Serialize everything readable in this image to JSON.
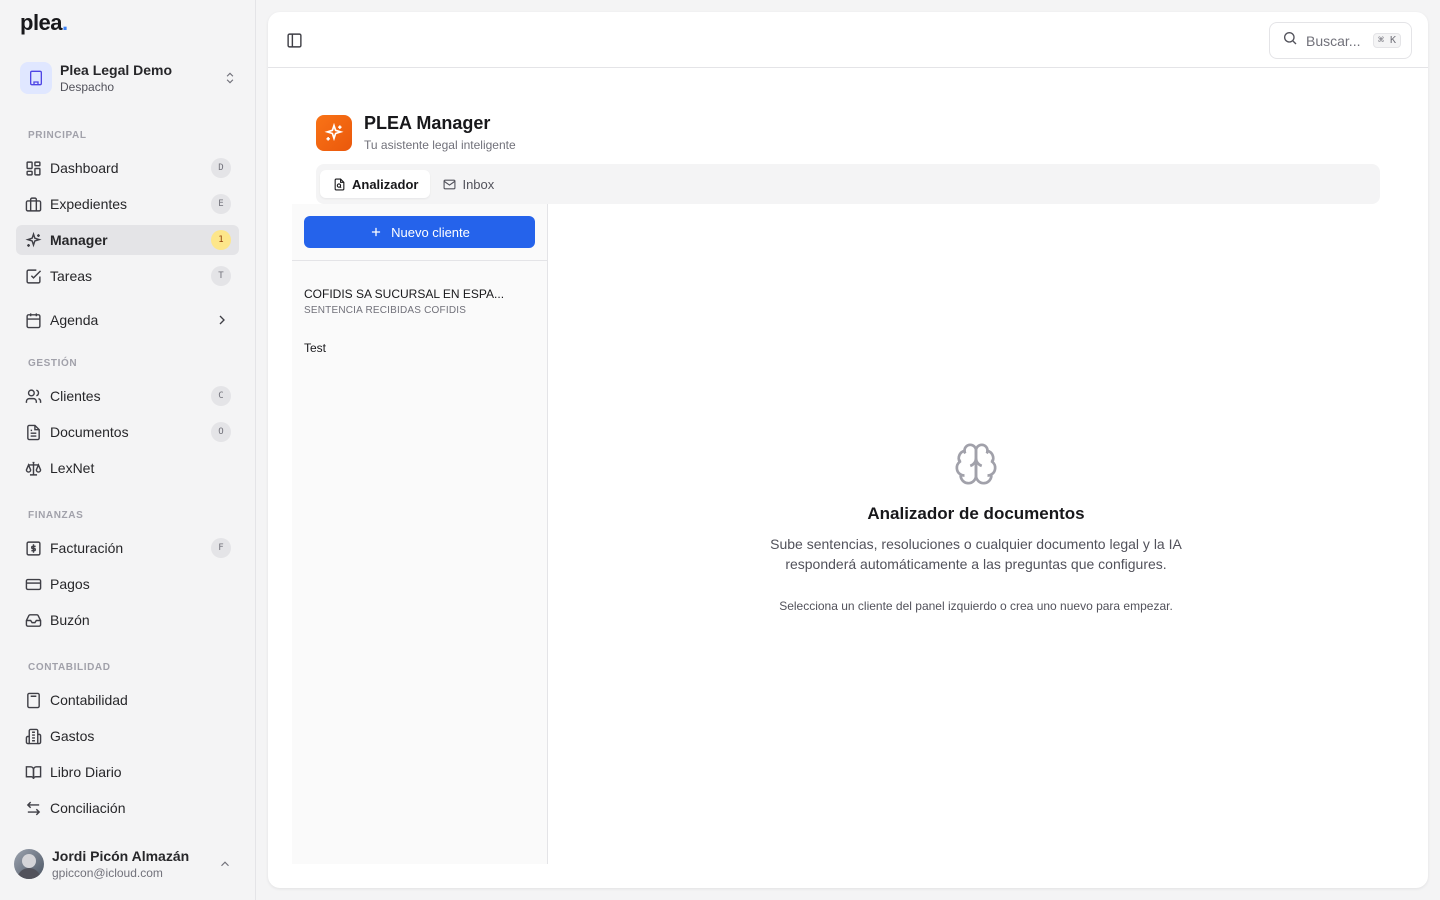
{
  "brand": {
    "logo_text": "plea",
    "logo_dot": "."
  },
  "org": {
    "name": "Plea Legal Demo",
    "subtitle": "Despacho"
  },
  "sidebar": {
    "sections": {
      "principal": "PRINCIPAL",
      "gestion": "GESTIÓN",
      "finanzas": "FINANZAS",
      "contabilidad": "CONTABILIDAD"
    },
    "items": {
      "dashboard": {
        "label": "Dashboard",
        "badge": "D",
        "icon": "dashboard-icon"
      },
      "expedientes": {
        "label": "Expedientes",
        "badge": "E",
        "icon": "briefcase-icon"
      },
      "manager": {
        "label": "Manager",
        "badge": "1",
        "icon": "sparkles-icon"
      },
      "tareas": {
        "label": "Tareas",
        "badge": "T",
        "icon": "checkbox-icon"
      },
      "agenda": {
        "label": "Agenda",
        "icon": "calendar-icon"
      },
      "clientes": {
        "label": "Clientes",
        "badge": "C",
        "icon": "users-icon"
      },
      "documentos": {
        "label": "Documentos",
        "badge": "O",
        "icon": "document-icon"
      },
      "lexnet": {
        "label": "LexNet",
        "icon": "scale-icon"
      },
      "facturacion": {
        "label": "Facturación",
        "badge": "F",
        "icon": "invoice-icon"
      },
      "pagos": {
        "label": "Pagos",
        "icon": "credit-card-icon"
      },
      "buzon": {
        "label": "Buzón",
        "icon": "inbox-icon"
      },
      "contabilidad": {
        "label": "Contabilidad",
        "icon": "calculator-icon"
      },
      "gastos": {
        "label": "Gastos",
        "icon": "receipt-icon"
      },
      "libro_diario": {
        "label": "Libro Diario",
        "icon": "book-icon"
      },
      "conciliacion": {
        "label": "Conciliación",
        "icon": "arrows-icon"
      }
    }
  },
  "user": {
    "name": "Jordi Picón Almazán",
    "email": "gpiccon@icloud.com"
  },
  "topbar": {
    "search_placeholder": "Buscar...",
    "shortcut": "⌘ K"
  },
  "app": {
    "title": "PLEA Manager",
    "subtitle": "Tu asistente legal inteligente"
  },
  "tabs": [
    {
      "label": "Analizador",
      "active": true
    },
    {
      "label": "Inbox",
      "active": false
    }
  ],
  "clients_panel": {
    "new_button": "Nuevo cliente",
    "clients": [
      {
        "name": "COFIDIS SA SUCURSAL EN ESPA...",
        "subtitle": "SENTENCIA RECIBIDAS COFIDIS"
      },
      {
        "name": "Test",
        "subtitle": ""
      }
    ]
  },
  "empty_state": {
    "title": "Analizador de documentos",
    "description": "Sube sentencias, resoluciones o cualquier documento legal y la IA responderá automáticamente a las preguntas que configures.",
    "hint": "Selecciona un cliente del panel izquierdo o crea uno nuevo para empezar."
  },
  "colors": {
    "accent": "#2563eb",
    "brand_orange": "#f97316",
    "badge_warn": "#fde68a"
  }
}
